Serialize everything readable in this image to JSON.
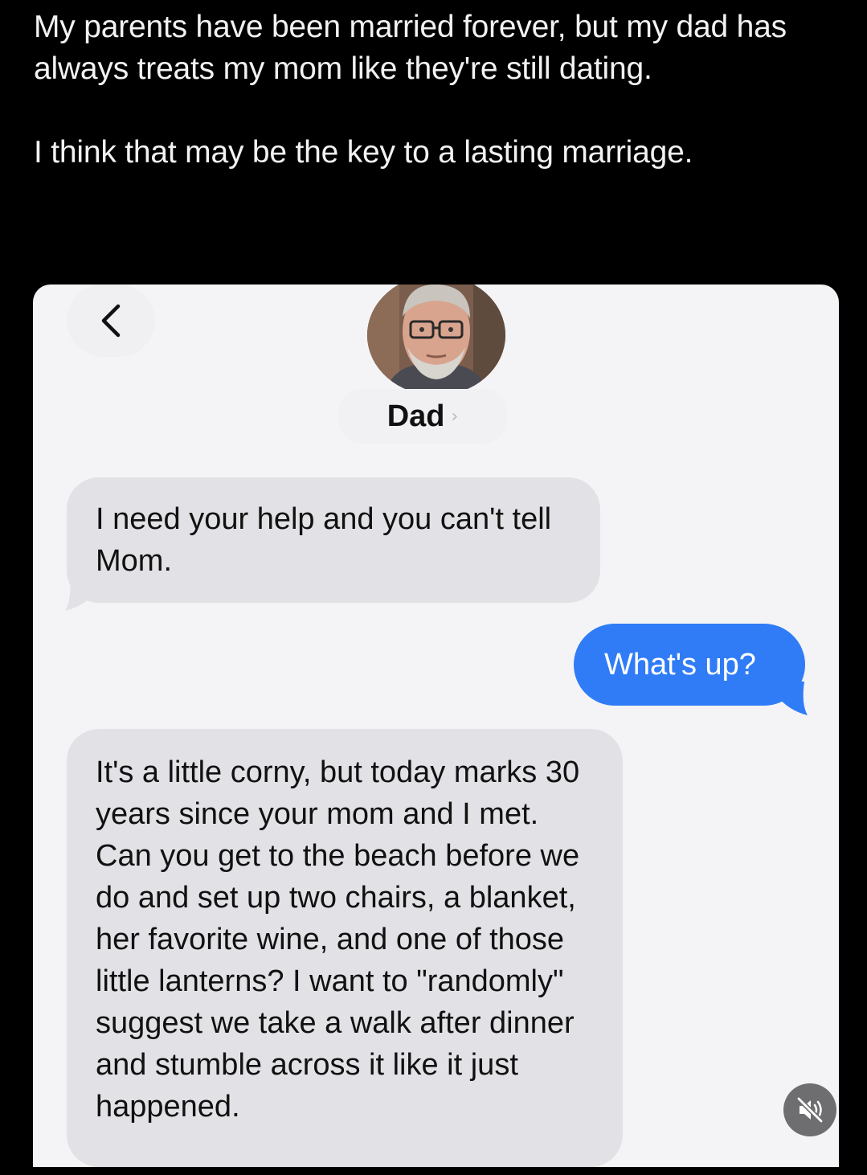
{
  "caption": {
    "line1": "My parents have been married forever, but my dad has always treats my mom like they're still dating.",
    "line2": "I think that may be the key to a lasting marriage."
  },
  "header": {
    "back_icon": "chevron-left-icon",
    "contact_name": "Dad",
    "contact_chevron": "›",
    "avatar_icon": "contact-photo"
  },
  "messages": [
    {
      "direction": "incoming",
      "text": "I need your help and you can't tell Mom."
    },
    {
      "direction": "outgoing",
      "text": "What's up?"
    },
    {
      "direction": "incoming",
      "text": "It's a little corny, but today marks 30 years since your mom and I met. Can you get to the beach before we do and set up two chairs, a blanket, her favorite wine, and one of those little lanterns? I want to \"randomly\" suggest we take a walk after dinner and stumble across it like it just happened."
    }
  ],
  "overlay": {
    "mute_icon": "speaker-muted-icon"
  },
  "colors": {
    "background": "#000000",
    "screen": "#f4f4f6",
    "incoming_bubble": "#e2e2e6",
    "outgoing_bubble": "#2f7cf6"
  }
}
